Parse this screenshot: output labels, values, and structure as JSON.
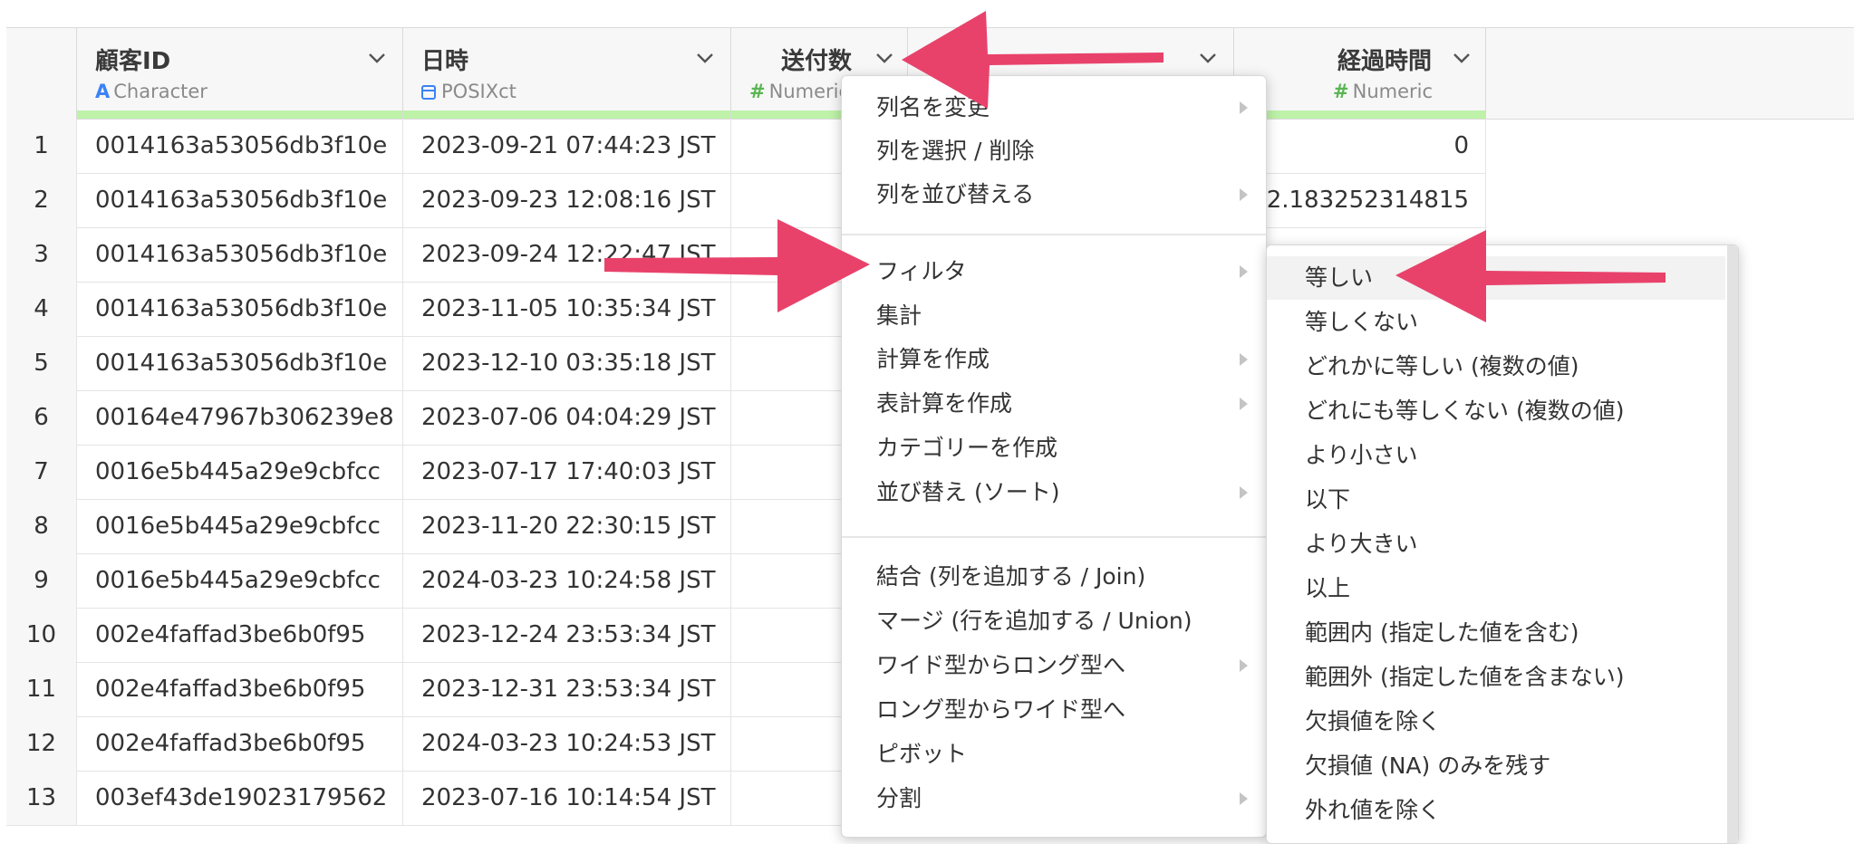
{
  "columns": [
    {
      "name": "顧客ID",
      "type": "Character",
      "type_icon": "A"
    },
    {
      "name": "日時",
      "type": "POSIXct",
      "type_icon": "calendar-icon"
    },
    {
      "name": "送付数",
      "type": "Numeric",
      "type_icon": "#"
    },
    {
      "name": "",
      "type": "",
      "type_icon": ""
    },
    {
      "name": "経過時間",
      "type": "Numeric",
      "type_icon": "#"
    }
  ],
  "rows": [
    {
      "idx": "1",
      "id": "0014163a53056db3f10e",
      "dt": "2023-09-21 07:44:23 JST",
      "sent": "",
      "elapsed": "0"
    },
    {
      "idx": "2",
      "id": "0014163a53056db3f10e",
      "dt": "2023-09-23 12:08:16 JST",
      "sent": "",
      "elapsed": "2.183252314815"
    },
    {
      "idx": "3",
      "id": "0014163a53056db3f10e",
      "dt": "2023-09-24 12:22:47 JST",
      "sent": "",
      "elapsed": ""
    },
    {
      "idx": "4",
      "id": "0014163a53056db3f10e",
      "dt": "2023-11-05 10:35:34 JST",
      "sent": "",
      "elapsed": ""
    },
    {
      "idx": "5",
      "id": "0014163a53056db3f10e",
      "dt": "2023-12-10 03:35:18 JST",
      "sent": "",
      "elapsed": ""
    },
    {
      "idx": "6",
      "id": "00164e47967b306239e8",
      "dt": "2023-07-06 04:04:29 JST",
      "sent": "",
      "elapsed": ""
    },
    {
      "idx": "7",
      "id": "0016e5b445a29e9cbfcc",
      "dt": "2023-07-17 17:40:03 JST",
      "sent": "",
      "elapsed": ""
    },
    {
      "idx": "8",
      "id": "0016e5b445a29e9cbfcc",
      "dt": "2023-11-20 22:30:15 JST",
      "sent": "",
      "elapsed": ""
    },
    {
      "idx": "9",
      "id": "0016e5b445a29e9cbfcc",
      "dt": "2024-03-23 10:24:58 JST",
      "sent": "",
      "elapsed": ""
    },
    {
      "idx": "10",
      "id": "002e4faffad3be6b0f95",
      "dt": "2023-12-24 23:53:34 JST",
      "sent": "",
      "elapsed": ""
    },
    {
      "idx": "11",
      "id": "002e4faffad3be6b0f95",
      "dt": "2023-12-31 23:53:34 JST",
      "sent": "",
      "elapsed": ""
    },
    {
      "idx": "12",
      "id": "002e4faffad3be6b0f95",
      "dt": "2024-03-23 10:24:53 JST",
      "sent": "",
      "elapsed": ""
    },
    {
      "idx": "13",
      "id": "003ef43de19023179562",
      "dt": "2023-07-16 10:14:54 JST",
      "sent": "",
      "elapsed": ""
    }
  ],
  "menu": {
    "items": [
      {
        "label": "列名を変更",
        "sub": true
      },
      {
        "label": "列を選択 / 削除",
        "sub": false
      },
      {
        "label": "列を並び替える",
        "sub": true
      },
      {
        "label": "フィルタ",
        "sub": true
      },
      {
        "label": "集計",
        "sub": false
      },
      {
        "label": "計算を作成",
        "sub": true
      },
      {
        "label": "表計算を作成",
        "sub": true
      },
      {
        "label": "カテゴリーを作成",
        "sub": false
      },
      {
        "label": "並び替え (ソート)",
        "sub": true
      },
      {
        "label": "結合 (列を追加する / Join)",
        "sub": false
      },
      {
        "label": "マージ (行を追加する / Union)",
        "sub": false
      },
      {
        "label": "ワイド型からロング型へ",
        "sub": true
      },
      {
        "label": "ロング型からワイド型へ",
        "sub": false
      },
      {
        "label": "ピボット",
        "sub": false
      },
      {
        "label": "分割",
        "sub": true
      }
    ]
  },
  "submenu": {
    "items": [
      "等しい",
      "等しくない",
      "どれかに等しい (複数の値)",
      "どれにも等しくない (複数の値)",
      "より小さい",
      "以下",
      "より大きい",
      "以上",
      "範囲内 (指定した値を含む)",
      "範囲外 (指定した値を含まない)",
      "欠損値を除く",
      "欠損値 (NA) のみを残す",
      "外れ値を除く"
    ]
  },
  "colors": {
    "accent_arrow": "#e8426b",
    "type_character": "#3b82f6",
    "type_numeric": "#5ab552",
    "quality_bar": "#bdf2a8"
  }
}
